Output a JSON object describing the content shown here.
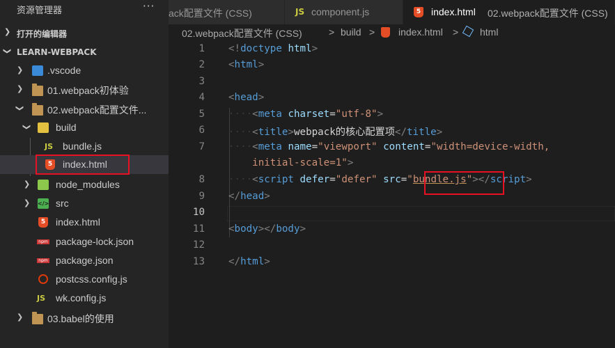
{
  "explorer": {
    "title": "资源管理器",
    "more_label": "···",
    "open_editors_label": "打开的编辑器",
    "workspace_label": "LEARN-WEBPACK",
    "items": [
      {
        "label": ".vscode",
        "icon": "vscode-folder-icon"
      },
      {
        "label": "01.webpack初体验",
        "icon": "folder-icon"
      },
      {
        "label": "02.webpack配置文件...",
        "icon": "folder-open-icon"
      },
      {
        "label": "build",
        "icon": "build-folder-icon"
      },
      {
        "label": "bundle.js",
        "icon": "js-file-icon"
      },
      {
        "label": "index.html",
        "icon": "html-file-icon"
      },
      {
        "label": "node_modules",
        "icon": "node-folder-icon"
      },
      {
        "label": "src",
        "icon": "src-folder-icon"
      },
      {
        "label": "index.html",
        "icon": "html-file-icon"
      },
      {
        "label": "package-lock.json",
        "icon": "npm-file-icon"
      },
      {
        "label": "package.json",
        "icon": "npm-file-icon"
      },
      {
        "label": "postcss.config.js",
        "icon": "postcss-file-icon"
      },
      {
        "label": "wk.config.js",
        "icon": "js-file-icon"
      },
      {
        "label": "03.babel的使用",
        "icon": "folder-icon"
      }
    ]
  },
  "tabs": [
    {
      "label": "ack配置文件 (CSS)"
    },
    {
      "label": "component.js",
      "icon_text": "JS"
    },
    {
      "label": "index.html",
      "detail": "02.webpack配置文件 (CSS)",
      "icon_text": "5"
    }
  ],
  "breadcrumb": {
    "parts": [
      "02.webpack配置文件 (CSS)",
      "build",
      "index.html",
      "html"
    ],
    "separator": ">"
  },
  "editor": {
    "line_numbers": [
      "1",
      "2",
      "3",
      "4",
      "5",
      "6",
      "7",
      "",
      "8",
      "9",
      "10",
      "11",
      "12",
      "13"
    ],
    "current_line": "10",
    "code": {
      "l1_open": "<!",
      "l1_tag": "doctype",
      "l1_attr": "html",
      "l1_close": ">",
      "l2_tag": "html",
      "l4_tag": "head",
      "l5_tag": "meta",
      "l5_attr": "charset",
      "l5_val": "\"utf-8\"",
      "l6_tag": "title",
      "l6_text": "webpack的核心配置项",
      "l7_tag": "meta",
      "l7_attr1": "name",
      "l7_val1": "\"viewport\"",
      "l7_attr2": "content",
      "l7_val2": "\"width=device-width,",
      "l7b_val": "initial-scale=1\"",
      "l8_tag": "script",
      "l8_attr1": "defer",
      "l8_val1": "\"defer\"",
      "l8_attr2": "src",
      "l8_val2_q": "\"",
      "l8_val2": "bundle.js",
      "l9_tag": "head",
      "l11_tag1": "body",
      "l11_tag2": "body",
      "l13_tag": "html"
    }
  },
  "colors": {
    "highlight_box": "#e81123",
    "tag": "#569cd6",
    "attribute": "#9cdcfe",
    "string": "#ce9178"
  }
}
